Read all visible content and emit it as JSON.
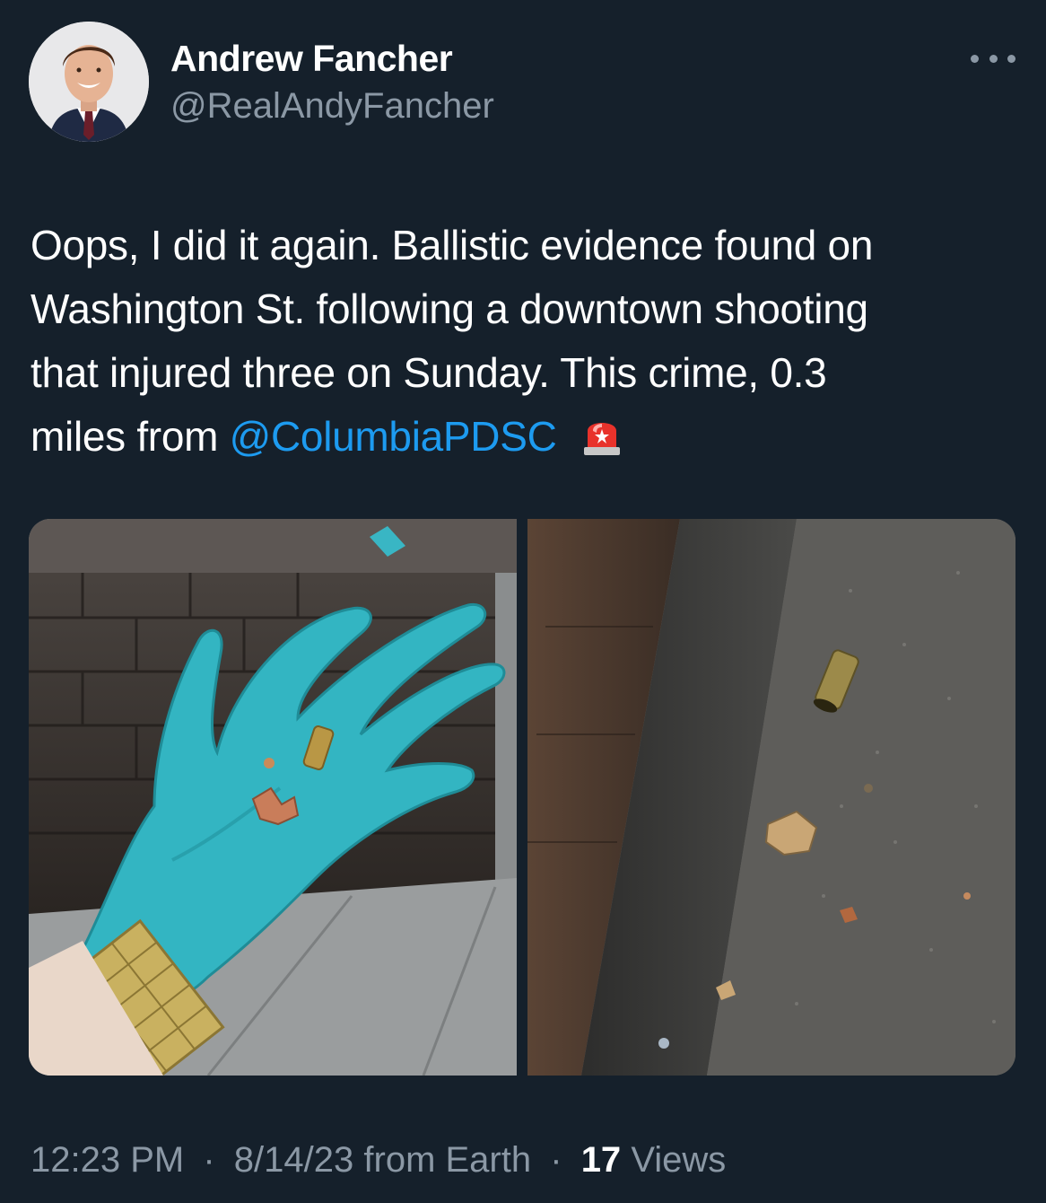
{
  "author": {
    "display_name": "Andrew Fancher",
    "handle": "@RealAndyFancher",
    "avatar_icon": "profile-photo"
  },
  "more_icon": "ellipsis-icon",
  "tweet": {
    "line1": "Oops, I did it again. Ballistic evidence found on",
    "line2": "Washington St. following a downtown shooting",
    "line3": "that injured three on Sunday. This crime, 0.3",
    "line4_prefix": "miles from",
    "mention": "@ColumbiaPDSC",
    "emoji": "police-light-emoji"
  },
  "media": [
    {
      "icon": "photo-gloved-hand-with-bullet-casings"
    },
    {
      "icon": "photo-casing-on-curb"
    }
  ],
  "meta": {
    "time": "12:23 PM",
    "separator": "·",
    "date": "8/14/23",
    "source": "from Earth",
    "views_count": "17",
    "views_label": "Views"
  },
  "colors": {
    "background": "#15202b",
    "text": "#ffffff",
    "secondary": "#8b98a5",
    "link": "#1d9bf0"
  }
}
